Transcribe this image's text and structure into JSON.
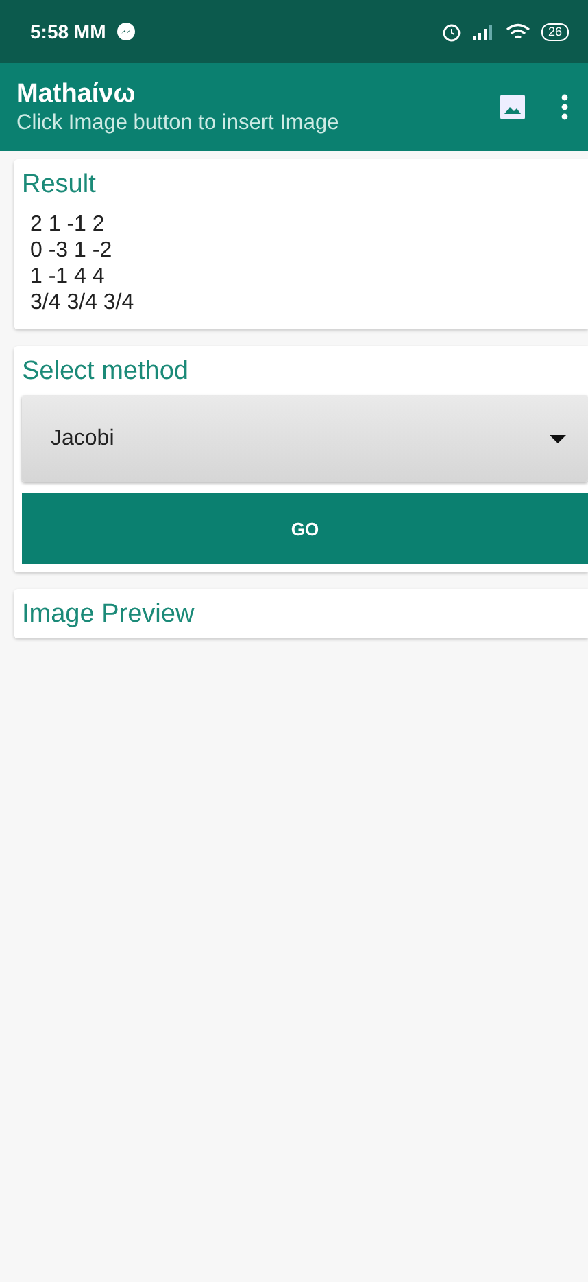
{
  "status_bar": {
    "time": "5:58 MM",
    "battery": "26"
  },
  "app_bar": {
    "title": "Mathaίνω",
    "subtitle": "Click Image button to insert Image"
  },
  "result": {
    "title": "Result",
    "lines": [
      "2 1 -1 2",
      "0 -3 1 -2",
      "1 -1 4 4",
      "3/4 3/4 3/4"
    ]
  },
  "method": {
    "title": "Select method",
    "value": "Jacobi",
    "button": "GO"
  },
  "preview": {
    "title": "Image Preview"
  }
}
